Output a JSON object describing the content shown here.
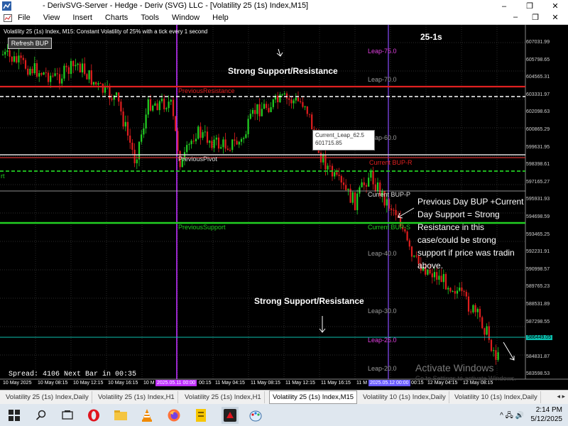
{
  "window": {
    "title": "- DerivSVG-Server - Hedge - Deriv (SVG) LLC - [Volatility 25 (1s) Index,M15]",
    "controls": [
      "–",
      "❐",
      "✕"
    ]
  },
  "menu": {
    "items": [
      "File",
      "View",
      "Insert",
      "Charts",
      "Tools",
      "Window",
      "Help"
    ],
    "mdi_controls": [
      "–",
      "❐",
      "✕"
    ]
  },
  "chart": {
    "header": "Volatility 25 (1s) Index, M15:  Constant Volatility of 25% with a tick every 1 second",
    "refresh_label": "Refresh BUP",
    "timeframe_label": "25-1s",
    "annotation_top": "Strong Support/Resistance",
    "annotation_bottom": "Strong Support/Resistance",
    "annotation_right": "Previous Day BUP +Current Day Support = Strong Resistance in this case/could be strong support if price was tradin above.",
    "levels": {
      "leap75": "Leap-75.0",
      "leap70": "Leap-70.0",
      "prev_resistance": "PreviousResistance",
      "leap60": "Leap-60.0",
      "prev_pivot": "PreviousPivot",
      "current_bup_r": "Current BUP-R",
      "current_bup_p": "Current BUP-P",
      "prev_support": "PreviousSupport",
      "current_bup_s": "Current BUP-S",
      "leap40": "Leap-40.0",
      "leap30": "Leap-30.0",
      "leap25": "Leap-25.0",
      "leap20": "Leap-20.0"
    },
    "left_marker": "rt",
    "tooltip_title": "Current_Leap_62.5",
    "tooltip_value": "601715.85",
    "spread_text": "Spread: 4106 Next Bar in 00:35",
    "watermark": "Activate Windows",
    "watermark_sub": "Go to Settings to activate Windows.",
    "price_ticks": [
      "607031.99",
      "605798.65",
      "604565.31",
      "603331.97",
      "602098.63",
      "600865.29",
      "599631.95",
      "598398.61",
      "597165.27",
      "595931.93",
      "594698.59",
      "593465.25",
      "592231.91",
      "590998.57",
      "589765.23",
      "588531.89",
      "587298.55",
      "586065.21",
      "584831.87",
      "583598.53"
    ],
    "current_price": "586449.05",
    "time_labels": [
      "10 May 2025",
      "10 May 08:15",
      "10 May 12:15",
      "10 May 16:15",
      "10 M",
      "00:15",
      "11 May 04:15",
      "11 May 08:15",
      "11 May 12:15",
      "11 May 16:15",
      "11 M",
      "00:15",
      "12 May 04:15",
      "12 May 08:15"
    ],
    "time_highlights": [
      "2025.05.11 00:00",
      "2025.05.12 00:00"
    ],
    "colors": {
      "resistance": "#e02020",
      "support": "#22d022",
      "pivot": "#ffffff",
      "vline": "#c030ff",
      "vline2": "#7070ff",
      "leap_gray": "#9a9a9a",
      "leap_magenta": "#e040e0",
      "teal": "#0bbfae"
    }
  },
  "symbol_tabs": [
    "Volatility 25 (1s) Index,Daily",
    "Volatility 25 (1s) Index,H1",
    "Volatility 25 (1s) Index,H1",
    "Volatility 25 (1s) Index,M15",
    "Volatility 10 (1s) Index,Daily",
    "Volatility 10 (1s) Index,Daily"
  ],
  "tab_arrows": "◂ ▸",
  "taskbar": {
    "icons": [
      "windows-start-icon",
      "search-icon",
      "task-view-icon",
      "opera-icon",
      "file-explorer-icon",
      "vlc-icon",
      "firefox-icon",
      "sticky-icon",
      "deriv-mt5-icon",
      "paint-icon"
    ],
    "tray_symbols": "^ 🖧 🔊",
    "time": "2:14 PM",
    "date": "5/12/2025"
  }
}
